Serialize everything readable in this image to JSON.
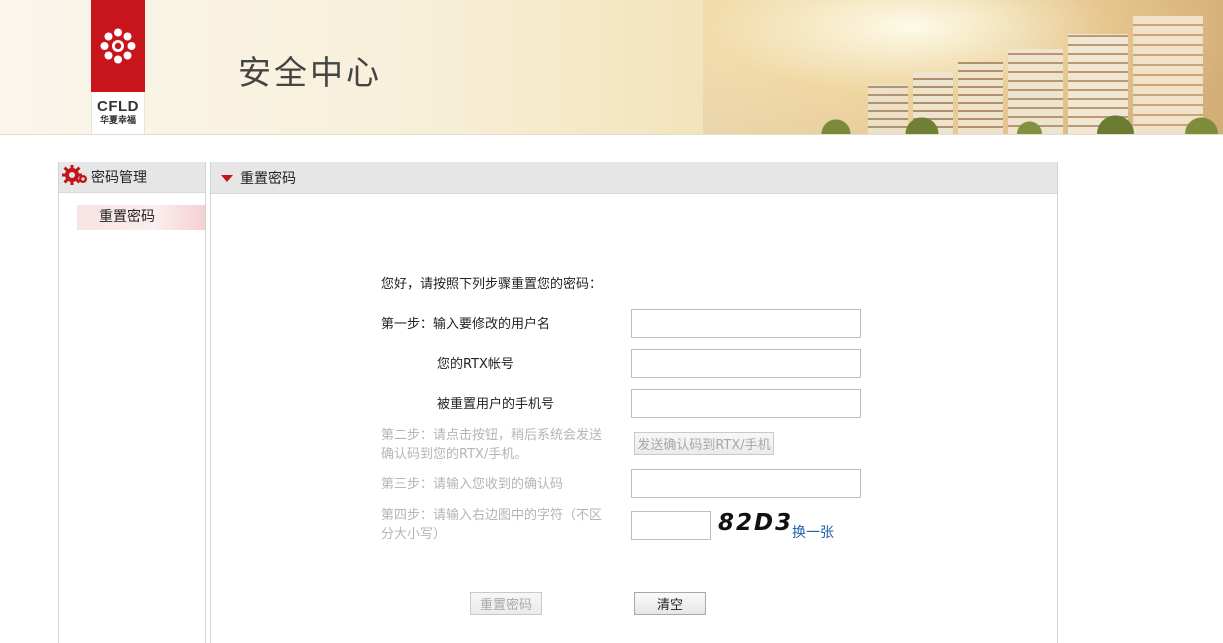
{
  "header": {
    "title": "安全中心",
    "logo": {
      "brand": "CFLD",
      "subtitle": "华夏幸福"
    }
  },
  "sidebar": {
    "heading": "密码管理",
    "heading_icon": "gear-icon",
    "items": [
      {
        "label": "重置密码",
        "selected": true
      }
    ]
  },
  "main": {
    "heading": "重置密码",
    "intro": "您好，请按照下列步骤重置您的密码：",
    "step1": {
      "label": "第一步：输入要修改的用户名",
      "username_value": "",
      "rtx_label": "您的RTX帐号",
      "rtx_value": "",
      "phone_label": "被重置用户的手机号",
      "phone_value": ""
    },
    "step2": {
      "label_line1": "第二步：请点击按钮，稍后系统会发送",
      "label_line2": "确认码到您的RTX/手机。",
      "send_button": "发送确认码到RTX/手机"
    },
    "step3": {
      "label": "第三步：请输入您收到的确认码",
      "code_value": ""
    },
    "step4": {
      "label_line1": "第四步：请输入右边图中的字符（不区",
      "label_line2": "分大小写）",
      "captcha_value": "",
      "captcha_text": "82D3",
      "refresh_link": "换一张"
    },
    "buttons": {
      "reset": "重置密码",
      "clear": "清空"
    }
  },
  "colors": {
    "brand_red": "#c8141b",
    "panel_header": "#e7e6e6",
    "link_blue": "#1f5fa8",
    "muted_text": "#b5b5b5"
  }
}
